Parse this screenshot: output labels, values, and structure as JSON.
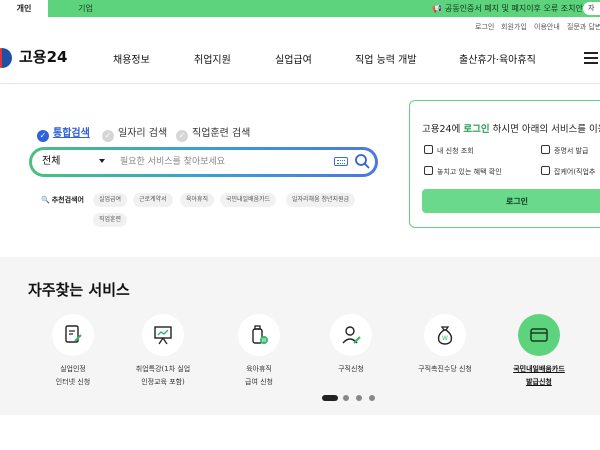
{
  "audience": {
    "personal": "개인",
    "company": "기업"
  },
  "notice": {
    "text": "공동인증서 폐지 및 폐지이후 오류 조치안내",
    "more": "자"
  },
  "util_links": [
    "로그인",
    "회원가입",
    "이용안내",
    "질문과 답변"
  ],
  "logo": {
    "text": "고용24"
  },
  "nav": [
    "채용정보",
    "취업지원",
    "실업급여",
    "직업 능력 개발",
    "출산휴가·육아휴직"
  ],
  "search": {
    "tabs": [
      "통합검색",
      "일자리 검색",
      "직업훈련 검색"
    ],
    "scope": "전체",
    "placeholder": "필요한 서비스를 찾아보세요"
  },
  "recommended": {
    "label": "추천검색어",
    "keywords": [
      "실업급여",
      "근로계약서",
      "육아휴직",
      "국민내일배움카드",
      "일자리채움 청년지원금",
      "직업훈련"
    ]
  },
  "login_panel": {
    "message_prefix": "고용24에 ",
    "message_highlight": "로그인",
    "message_suffix": " 하시면 아래의 서비스를 이용",
    "links": [
      "내 신청 조회",
      "증명서 발급",
      "놓치고 있는 혜택 확인",
      "잡케어(직업추"
    ],
    "button": "로그인"
  },
  "frequent": {
    "title": "자주찾는 서비스",
    "services": [
      {
        "line1": "실업인정",
        "line2": "인터넷 신청",
        "icon": "document-pen-icon"
      },
      {
        "line1": "취업특강(1차 실업",
        "line2": "인정교육 포함)",
        "icon": "lecture-board-icon"
      },
      {
        "line1": "육아휴직",
        "line2": "급여 신청",
        "icon": "baby-bottle-icon"
      },
      {
        "line1": "구직신청",
        "line2": "",
        "icon": "person-pen-icon"
      },
      {
        "line1": "구직촉진수당 신청",
        "line2": "",
        "icon": "money-bag-icon"
      },
      {
        "line1": "국민내일배움카드",
        "line2": "발급신청",
        "icon": "card-icon"
      }
    ]
  }
}
